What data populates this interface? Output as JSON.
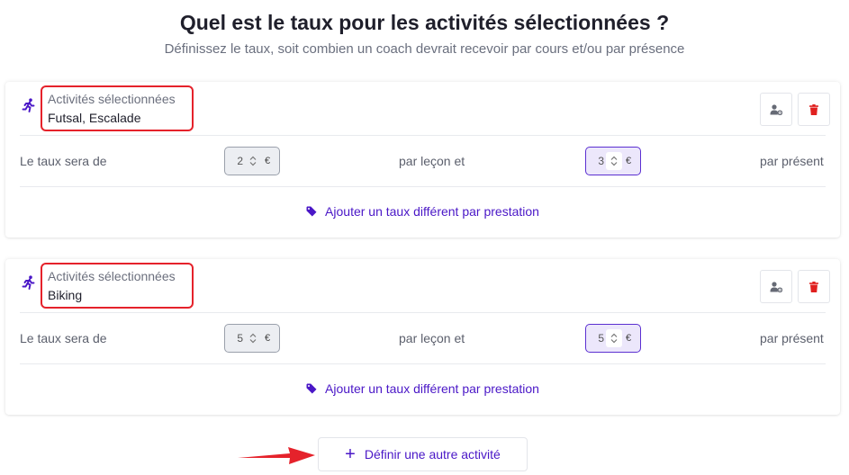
{
  "header": {
    "title": "Quel est le taux pour les activités sélectionnées ?",
    "subtitle": "Définissez le taux, soit combien un coach devrait recevoir par cours et/ou par présence"
  },
  "colors": {
    "accent": "#4a17c7",
    "highlight": "#e5222b",
    "delete": "#e0201f"
  },
  "icons": {
    "activity": "running-person-icon",
    "coach": "user-gear-icon",
    "delete": "trash-icon",
    "tag": "tag-icon",
    "spinner": "chevron-up-down-icon",
    "add": "plus-icon"
  },
  "activities": [
    {
      "selected_label": "Activités sélectionnées",
      "selected_value": "Futsal, Escalade",
      "rate_label": "Le taux sera de",
      "rate_per_lesson": "2",
      "currency": "€",
      "per_lesson_label": "par leçon et",
      "rate_per_presence": "3",
      "per_presence_label": "par présent",
      "add_different_rate": "Ajouter un taux différent par prestation"
    },
    {
      "selected_label": "Activités sélectionnées",
      "selected_value": "Biking",
      "rate_label": "Le taux sera de",
      "rate_per_lesson": "5",
      "currency": "€",
      "per_lesson_label": "par leçon et",
      "rate_per_presence": "5",
      "per_presence_label": "par présent",
      "add_different_rate": "Ajouter un taux différent par prestation"
    }
  ],
  "define_other": {
    "plus": "+",
    "label": "Définir une autre activité"
  }
}
